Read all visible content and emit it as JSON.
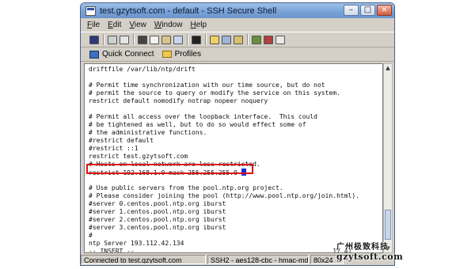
{
  "window": {
    "title": "test.gzytsoft.com - default - SSH Secure Shell"
  },
  "menu": [
    "File",
    "Edit",
    "View",
    "Window",
    "Help"
  ],
  "quickbar": {
    "quick_connect": "Quick Connect",
    "profiles": "Profiles"
  },
  "terminal": {
    "lines": [
      "driftfile /var/lib/ntp/drift",
      "",
      "# Permit time synchronization with our time source, but do not",
      "# permit the source to query or modify the service on this system.",
      "restrict default nomodify notrap nopeer noquery",
      "",
      "# Permit all access over the loopback interface.  This could",
      "# be tightened as well, but to do so would effect some of",
      "# the administrative functions.",
      "#restrict default",
      "#restrict ::1",
      "restrict test.gzytsoft.com",
      "# Hosts on local network are less restricted.",
      "restrict 192.168.1.0 mask 255.255.255.0 ",
      "",
      "# Use public servers from the pool.ntp.org project.",
      "# Please consider joining the pool (http://www.pool.ntp.org/join.html).",
      "#server 0.centos.pool.ntp.org iburst",
      "#server 1.centos.pool.ntp.org iburst",
      "#server 2.centos.pool.ntp.org iburst",
      "#server 3.centos.pool.ntp.org iburst",
      "#",
      "ntp Server 193.112.42.134",
      "-- INSERT --                                                    17,41"
    ]
  },
  "status": {
    "connection": "Connected to test.gzytsoft.com",
    "protocol": "SSH2 - aes128-cbc - hmac-md5",
    "size": "80x24"
  },
  "watermark": {
    "line1": "广州极致科技",
    "line2": "gzytsoft.com"
  },
  "colors": {
    "highlight": "#e01414",
    "cursor": "#1b2bd6",
    "titlebar": "#7aa3d8"
  }
}
